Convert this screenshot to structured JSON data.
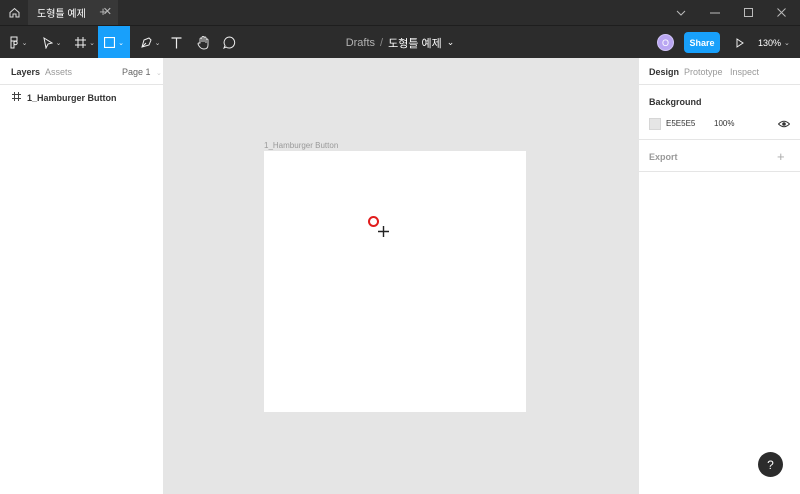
{
  "tabbar": {
    "home_icon": "home-icon",
    "tab_title": "도형틀 예제",
    "tab_close": "✕",
    "new_tab": "+",
    "minimize_icon": "chevron-down-icon"
  },
  "toolbar": {
    "breadcrumb_drafts": "Drafts",
    "breadcrumb_sep": "/",
    "file_name": "도형틀 예제",
    "avatar_initial": "O",
    "share_label": "Share",
    "zoom_label": "130%"
  },
  "left_panel": {
    "tabs": {
      "layers": "Layers",
      "assets": "Assets",
      "page": "Page 1"
    },
    "layers": [
      {
        "icon": "frame-icon",
        "label": "1_Hamburger Button"
      }
    ]
  },
  "canvas": {
    "frame_label": "1_Hamburger Button"
  },
  "right_panel": {
    "tabs": {
      "design": "Design",
      "prototype": "Prototype",
      "inspect": "Inspect"
    },
    "background": {
      "title": "Background",
      "hex": "E5E5E5",
      "opacity": "100%"
    },
    "export": {
      "title": "Export"
    }
  },
  "help_label": "?",
  "colors": {
    "accent": "#18a0fb",
    "toolbar_bg": "#2c2c2c",
    "canvas_bg": "#e5e5e5"
  }
}
